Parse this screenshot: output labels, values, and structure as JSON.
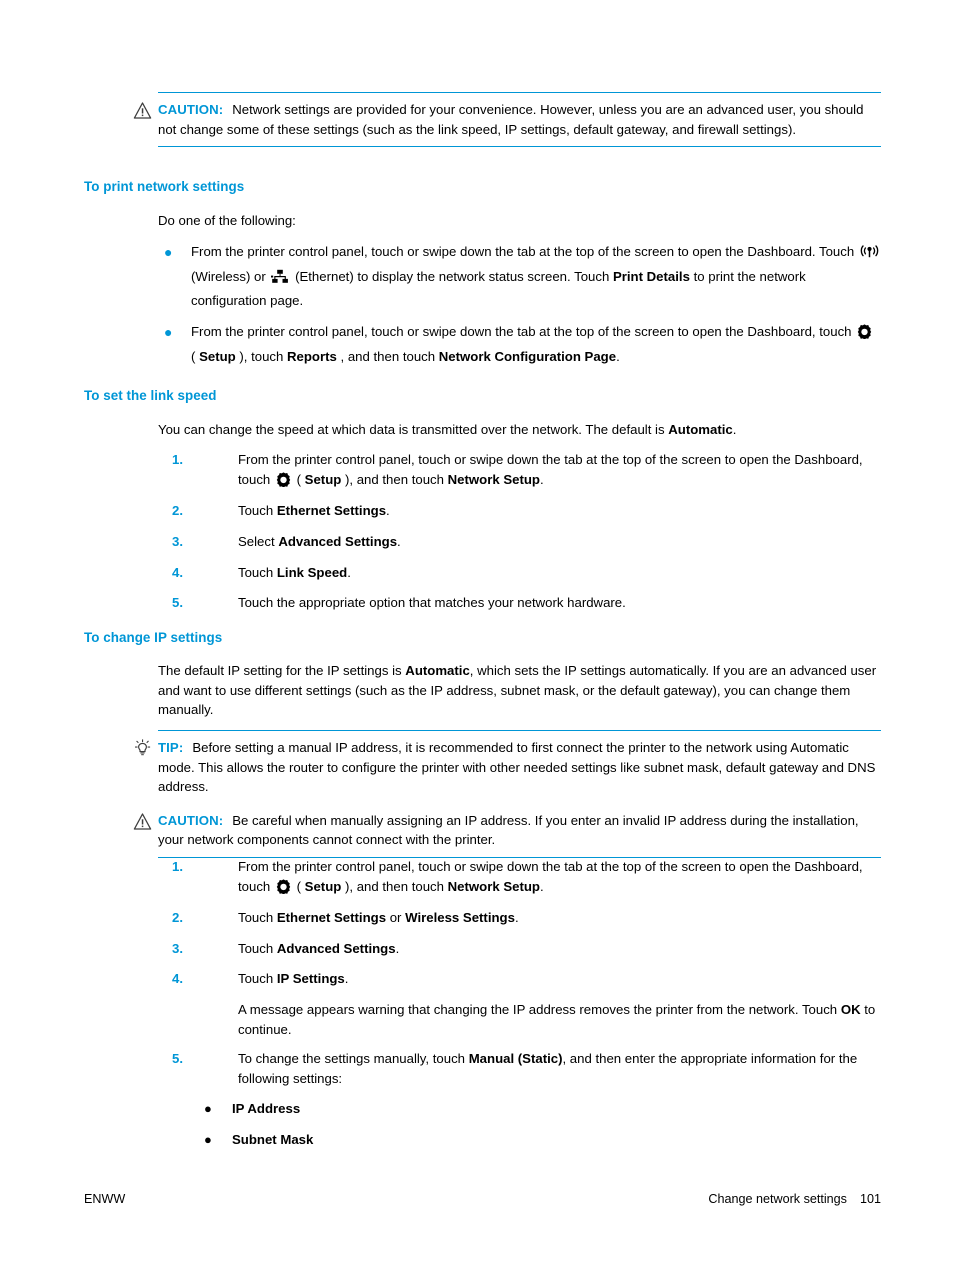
{
  "page": {
    "footer_left": "ENWW",
    "footer_section": "Change network settings",
    "footer_pageno": "101"
  },
  "colors": {
    "accent": "#0096d6",
    "text": "#000000",
    "background": "#ffffff"
  },
  "admonitions": {
    "caution_top": {
      "label": "CAUTION:",
      "icon": "warning-triangle-icon",
      "text_parts": [
        "Network settings are provided for your convenience. However, unless you are an advanced user, you should not change some of these settings (such as the link speed, IP settings, default gateway, and firewall settings)."
      ],
      "full_text": "Network settings are provided for your convenience. However, unless you are an advanced user, you should not change some of these settings (such as the link speed, IP settings, default gateway, and firewall settings)."
    },
    "tip": {
      "label": "TIP:",
      "icon": "lightbulb-icon",
      "full_text": "Before setting a manual IP address, it is recommended to first connect the printer to the network using Automatic mode. This allows the router to configure the printer with other needed settings like subnet mask, default gateway and DNS address."
    },
    "caution_ip": {
      "label": "CAUTION:",
      "icon": "warning-triangle-icon",
      "full_text": "Be careful when manually assigning an IP address. If you enter an invalid IP address during the installation, your network components cannot connect with the printer."
    }
  },
  "sections": {
    "print_network_settings": {
      "heading": "To print network settings",
      "intro": "Do one of the following:",
      "bullets": {
        "b1": {
          "p1": "From the printer control panel, touch or swipe down the tab at the top of the screen to open the Dashboard. Touch ",
          "wireless_label": " (Wireless) or ",
          "ethernet_label": " (Ethernet) to display the network status screen. Touch ",
          "bold1": "Print Details",
          "p2": " to print the network configuration page."
        },
        "b2": {
          "p1": "From the printer control panel, touch or swipe down the tab at the top of the screen to open the Dashboard, touch ",
          "setup_open": " ( ",
          "setup_bold": "Setup",
          "setup_close": " ), touch ",
          "reports_bold": "Reports",
          "mid": " , and then touch ",
          "netcfg_bold": "Network Configuration Page",
          "end": "."
        }
      }
    },
    "link_speed": {
      "heading": "To set the link speed",
      "intro_pre": "You can change the speed at which data is transmitted over the network. The default is ",
      "intro_bold": "Automatic",
      "intro_post": ".",
      "steps": {
        "s1": {
          "num": "1.",
          "p1": "From the printer control panel, touch or swipe down the tab at the top of the screen to open the Dashboard, touch ",
          "setup_open": " ( ",
          "setup_bold": "Setup",
          "setup_close": " ), and then touch ",
          "target_bold": "Network Setup",
          "end": "."
        },
        "s2": {
          "num": "2.",
          "pre": "Touch ",
          "bold": "Ethernet Settings",
          "post": "."
        },
        "s3": {
          "num": "3.",
          "pre": "Select ",
          "bold": "Advanced Settings",
          "post": "."
        },
        "s4": {
          "num": "4.",
          "pre": "Touch ",
          "bold": "Link Speed",
          "post": "."
        },
        "s5": {
          "num": "5.",
          "pre": "Touch the appropriate option that matches your network hardware.",
          "bold": "",
          "post": ""
        }
      }
    },
    "ip_settings": {
      "heading": "To change IP settings",
      "intro_pre": "The default IP setting for the IP settings is ",
      "intro_bold": "Automatic",
      "intro_post": ", which sets the IP settings automatically. If you are an advanced user and want to use different settings (such as the IP address, subnet mask, or the default gateway), you can change them manually.",
      "steps": {
        "s1": {
          "num": "1.",
          "p1": "From the printer control panel, touch or swipe down the tab at the top of the screen to open the Dashboard, touch ",
          "setup_open": " ( ",
          "setup_bold": "Setup",
          "setup_close": " ), and then touch ",
          "target_bold": "Network Setup",
          "end": "."
        },
        "s2": {
          "num": "2.",
          "pre": "Touch ",
          "bold1": "Ethernet Settings",
          "mid": " or ",
          "bold2": "Wireless Settings",
          "post": "."
        },
        "s3": {
          "num": "3.",
          "pre": "Touch ",
          "bold": "Advanced Settings",
          "post": "."
        },
        "s4": {
          "num": "4.",
          "pre": "Touch ",
          "bold": "IP Settings",
          "post": "."
        },
        "s4_note_pre": "A message appears warning that changing the IP address removes the printer from the network. Touch ",
        "s4_note_bold": "OK",
        "s4_note_post": " to continue.",
        "s5": {
          "num": "5.",
          "pre": "To change the settings manually, touch ",
          "bold": "Manual (Static)",
          "post": ", and then enter the appropriate information for the following settings:"
        },
        "sub_bullets": [
          "IP Address",
          "Subnet Mask"
        ]
      }
    }
  }
}
